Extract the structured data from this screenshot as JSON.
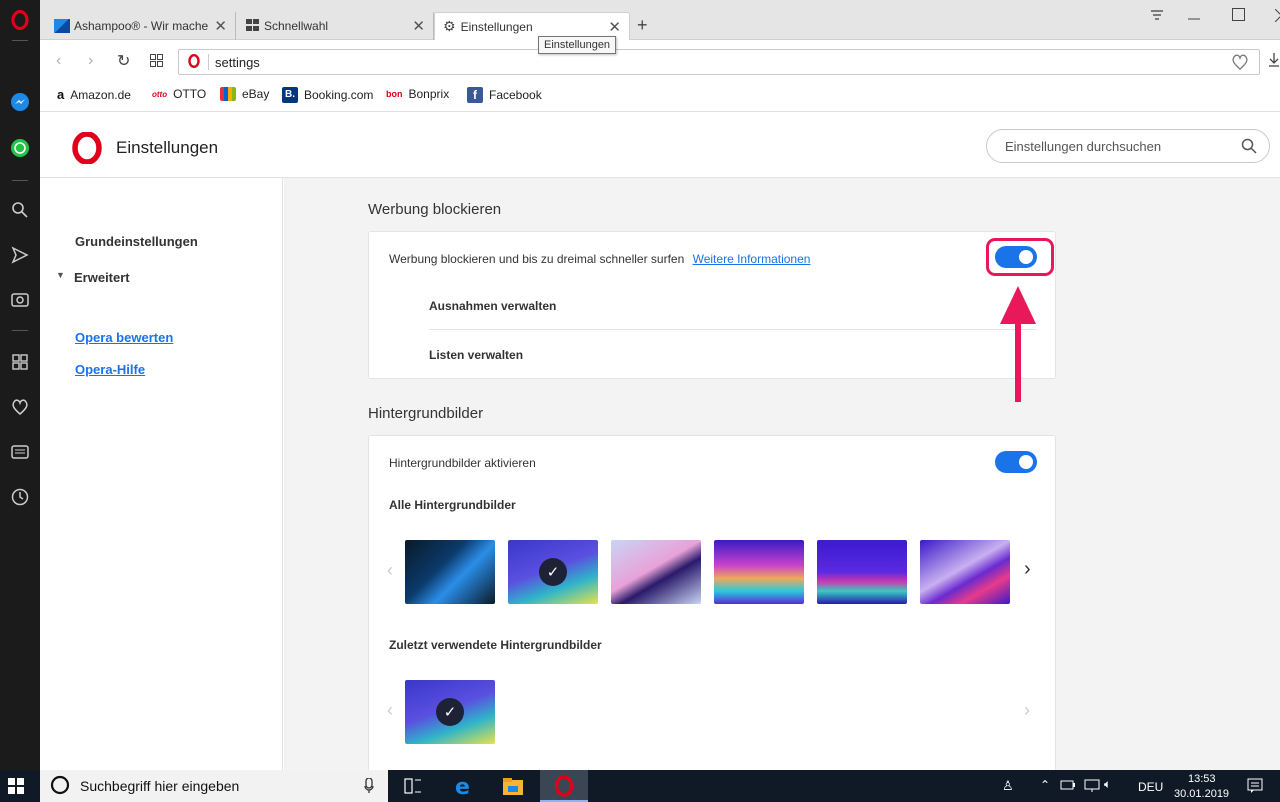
{
  "tabs": [
    {
      "title": "Ashampoo® - Wir machen",
      "icon": "ashampoo-icon"
    },
    {
      "title": "Schnellwahl",
      "icon": "speed-dial-icon"
    },
    {
      "title": "Einstellungen",
      "icon": "gear-icon"
    }
  ],
  "tooltip": "Einstellungen",
  "address": {
    "url": "settings"
  },
  "bookmarks": [
    {
      "label": "Amazon.de",
      "icon": "amazon-icon"
    },
    {
      "label": "OTTO",
      "icon": "otto-icon"
    },
    {
      "label": "eBay",
      "icon": "ebay-icon"
    },
    {
      "label": "Booking.com",
      "icon": "booking-icon"
    },
    {
      "label": "Bonprix",
      "icon": "bonprix-icon"
    },
    {
      "label": "Facebook",
      "icon": "facebook-icon"
    }
  ],
  "header": {
    "title": "Einstellungen",
    "search_placeholder": "Einstellungen durchsuchen"
  },
  "nav": {
    "basic": "Grundeinstellungen",
    "advanced": "Erweitert",
    "rate": "Opera bewerten",
    "help": "Opera-Hilfe"
  },
  "adblock": {
    "section_title": "Werbung blockieren",
    "label": "Werbung blockieren und bis zu dreimal schneller surfen",
    "link": "Weitere Informationen",
    "enabled": true,
    "exceptions": "Ausnahmen verwalten",
    "lists": "Listen verwalten"
  },
  "wallpapers": {
    "section_title": "Hintergrundbilder",
    "enable_label": "Hintergrundbilder aktivieren",
    "enabled": true,
    "all_title": "Alle Hintergrundbilder",
    "recent_title": "Zuletzt verwendete Hintergrundbilder"
  },
  "taskbar": {
    "search_placeholder": "Suchbegriff hier eingeben",
    "language": "DEU",
    "time": "13:53",
    "date": "30.01.2019"
  },
  "colors": {
    "accent": "#1a73e8",
    "highlight": "#e8185a",
    "opera_red": "#e0001b"
  }
}
